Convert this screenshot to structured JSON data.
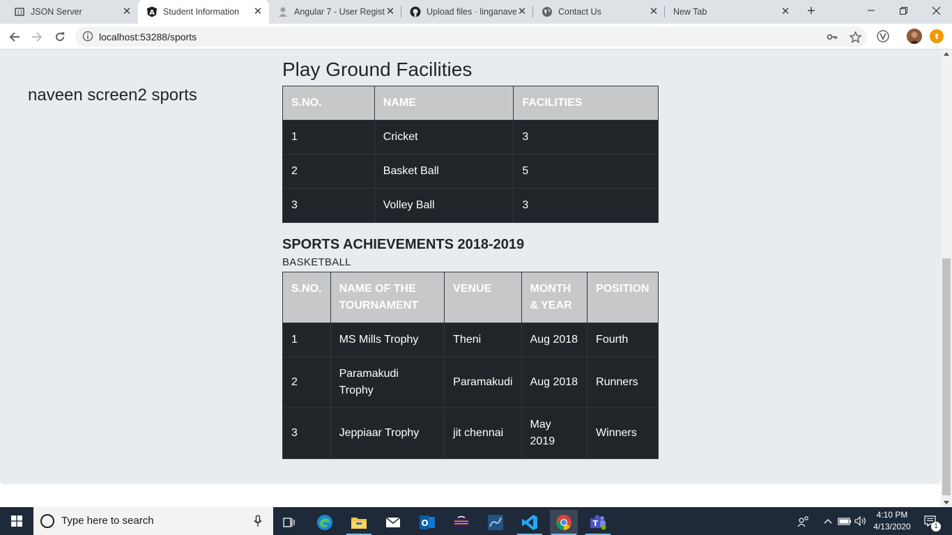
{
  "browser": {
    "tabs": [
      {
        "title": "JSON Server",
        "icon": "json-server-icon"
      },
      {
        "title": "Student Information",
        "icon": "angular-icon"
      },
      {
        "title": "Angular 7 - User Registr",
        "icon": "avatar-icon"
      },
      {
        "title": "Upload files · linganaveen",
        "icon": "github-icon"
      },
      {
        "title": "Contact Us",
        "icon": "globe-icon"
      },
      {
        "title": "New Tab",
        "icon": ""
      }
    ],
    "active_tab_index": 1,
    "url": "localhost:53288/sports"
  },
  "page": {
    "screen_label": "naveen screen2 sports",
    "playground": {
      "heading": "Play Ground Facilities",
      "columns": [
        "S.NO.",
        "NAME",
        "FACILITIES"
      ],
      "rows": [
        [
          "1",
          "Cricket",
          "3"
        ],
        [
          "2",
          "Basket Ball",
          "5"
        ],
        [
          "3",
          "Volley Ball",
          "3"
        ]
      ]
    },
    "achievements": {
      "heading": "SPORTS ACHIEVEMENTS 2018-2019",
      "subheading": "BASKETBALL",
      "columns": [
        "S.NO.",
        "NAME OF THE TOURNAMENT",
        "VENUE",
        "MONTH & YEAR",
        "POSITION"
      ],
      "rows": [
        [
          "1",
          "MS Mills Trophy",
          "Theni",
          "Aug 2018",
          "Fourth"
        ],
        [
          "2",
          "Paramakudi Trophy",
          "Paramakudi",
          "Aug 2018",
          "Runners"
        ],
        [
          "3",
          "Jeppiaar Trophy",
          "jit chennai",
          "May 2019",
          "Winners"
        ]
      ]
    }
  },
  "taskbar": {
    "search_placeholder": "Type here to search",
    "time": "4:10 PM",
    "date": "4/13/2020",
    "notification_count": "1"
  },
  "colors": {
    "page_background": "#e9ecef",
    "table_header": "#c6c8ca",
    "table_body": "#212529",
    "taskbar": "#1e2a3a"
  }
}
